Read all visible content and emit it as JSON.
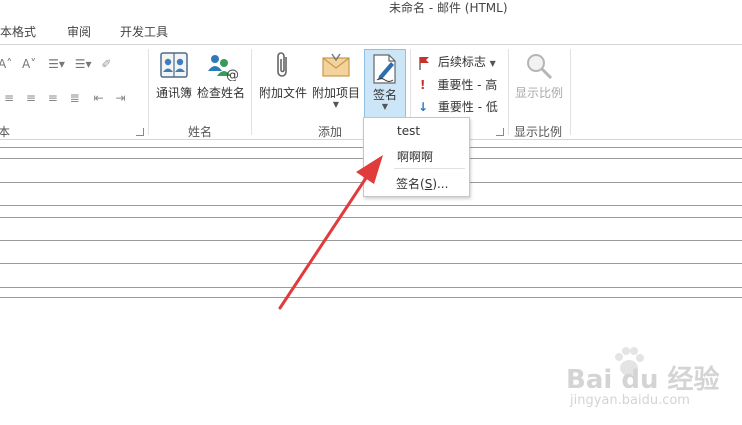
{
  "window": {
    "title": "未命名 - 邮件 (HTML)"
  },
  "tabs": [
    "文本格式",
    "审阅",
    "开发工具"
  ],
  "groups": {
    "basic_text": {
      "label": "本"
    },
    "names": {
      "label": "姓名",
      "address_book": "通讯簿",
      "check_names": "检查姓名"
    },
    "include": {
      "label": "添加",
      "attach_file": "附加文件",
      "attach_item": "附加项目",
      "signature": "签名"
    },
    "tags": {
      "follow_up": "后续标志",
      "high_importance": "重要性 - 高",
      "low_importance": "重要性 - 低"
    },
    "zoom": {
      "label": "显示比例",
      "zoom_button": "显示比例"
    }
  },
  "signature_menu": {
    "items": [
      "test",
      "啊啊啊"
    ],
    "manage": "签名(S)...",
    "manage_accel": "S"
  },
  "watermark": {
    "brand": "Bai du 经验",
    "site": "jingyan.baidu.com"
  },
  "colors": {
    "accent_selected": "#cde6f7",
    "arrow": "#e23b3b",
    "flag": "#c8312b",
    "low_arrow": "#2b78c4"
  }
}
